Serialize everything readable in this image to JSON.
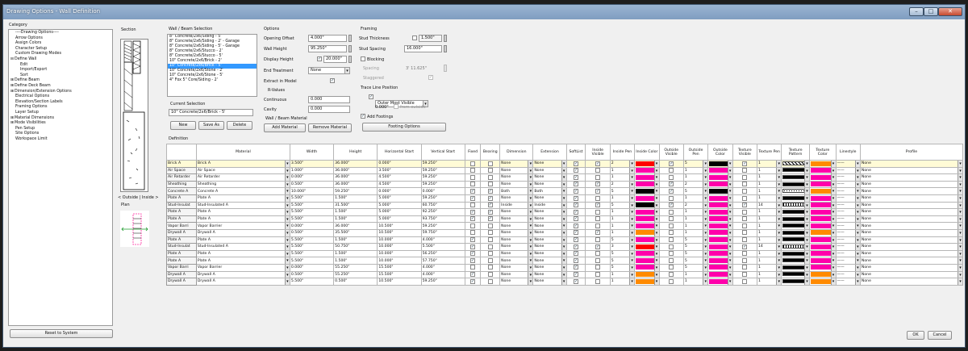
{
  "window": {
    "title": "Drawing Options - Wall Definition",
    "min": "–",
    "max": "□",
    "close": "✕"
  },
  "category": {
    "label": "Category",
    "items": [
      {
        "text": "----Drawing Options----",
        "indent": 1
      },
      {
        "text": "Arrow Options",
        "indent": 1
      },
      {
        "text": "Assign Colors",
        "indent": 1
      },
      {
        "text": "Character Setup",
        "indent": 1
      },
      {
        "text": "Custom Drawing Modes",
        "indent": 1
      },
      {
        "text": "Define Wall",
        "indent": 0,
        "exp": "⊟"
      },
      {
        "text": "Edit",
        "indent": 2
      },
      {
        "text": "Import/Export",
        "indent": 2
      },
      {
        "text": "Sort",
        "indent": 2
      },
      {
        "text": "Define Beam",
        "indent": 0,
        "exp": "⊞"
      },
      {
        "text": "Define Deck Beam",
        "indent": 0,
        "exp": "⊞"
      },
      {
        "text": "Dimension/Extension Options",
        "indent": 0,
        "exp": "⊞"
      },
      {
        "text": "Electrical Options",
        "indent": 1
      },
      {
        "text": "Elevation/Section Labels",
        "indent": 1
      },
      {
        "text": "Framing Options",
        "indent": 1
      },
      {
        "text": "Layer Setup",
        "indent": 1
      },
      {
        "text": "Material Dimensions",
        "indent": 0,
        "exp": "⊞"
      },
      {
        "text": "Mode Visibilities",
        "indent": 0,
        "exp": "⊞"
      },
      {
        "text": "Pen Setup",
        "indent": 1
      },
      {
        "text": "Site Options",
        "indent": 1
      },
      {
        "text": "Workspace Limit",
        "indent": 1
      }
    ]
  },
  "section": {
    "label": "Section",
    "outside_inside": "< Outside  |  Inside >",
    "plan": "Plan"
  },
  "wall_beam": {
    "label": "Wall / Beam Selection",
    "items": [
      "8\" Concrete/2x6/Siding - 5'",
      "8\" Concrete/2x6/Siding - 2' - Garage",
      "8\" Concrete/2x6/Siding - 5' - Garage",
      "8\" Concrete/2x6/Stucco - 2'",
      "8\" Concrete/2x6/Stucco - 5'",
      "10\" Concrete/2x6/Brick - 2'",
      "10\" Concrete/2x6/Brick - 5'",
      "10\" Concrete/2x6/Stone - 2'",
      "10\" Concrete/2x6/Stone - 5'",
      "4\" Fox 5\" Core/Siding - 2'"
    ],
    "selected_index": 6,
    "current_label": "Current Selection",
    "current_value": "10\" Concrete/2x6/Brick - 5'",
    "new": "New",
    "save_as": "Save As",
    "delete": "Delete"
  },
  "options": {
    "label": "Options",
    "opening_offset_label": "Opening Offset",
    "opening_offset": "4.000\"",
    "wall_height_label": "Wall Height",
    "wall_height": "95.250\"",
    "display_height_label": "Display Height",
    "display_height": "20.000\"",
    "end_treatment_label": "End Treatment",
    "end_treatment": "None",
    "extract_label": "Extract in Model",
    "rvalues_label": "R-Values",
    "continuous_label": "Continuous",
    "continuous": "0.000",
    "cavity_label": "Cavity",
    "cavity": "0.000",
    "material_label": "Wall / Beam Material",
    "add_material": "Add Material",
    "remove_material": "Remove Material"
  },
  "framing": {
    "label": "Framing",
    "stud_thickness_label": "Stud Thickness",
    "stud_thickness": "1.500\"",
    "stud_spacing_label": "Stud Spacing",
    "stud_spacing": "16.000\"",
    "blocking_label": "Blocking",
    "spacing_label": "Spacing",
    "spacing": "3' 11.625\"",
    "staggered_label": "Staggered",
    "trace_label": "Trace Line Position",
    "trace_value": "Outer Most Visible",
    "trace_offset": "0.000\"",
    "from_outside": "from outside",
    "add_footings": "Add Footings",
    "footing_options": "Footing Options"
  },
  "definition_label": "Definition",
  "columns": [
    "Material",
    "Width",
    "Height",
    "Horizontal Start",
    "Vertical Start",
    "Fixed",
    "Bearing",
    "Dimension",
    "Extension",
    "SoftList",
    "Inside Visible",
    "Inside Pen",
    "Inside Color",
    "Outside Visible",
    "Outside Pen",
    "Outside Color",
    "Texture Visible",
    "Texture Pen",
    "Texture Pattern",
    "Texture Color",
    "Linestyle",
    "Profile"
  ],
  "rows": [
    {
      "name": "Brick A",
      "material": "Brick A",
      "width": "3.500\"",
      "height": "36.000\"",
      "hstart": "0.000\"",
      "vstart": "59.250\"",
      "fixed": false,
      "bearing": false,
      "dim": "None",
      "ext": "None",
      "soft": true,
      "iv": true,
      "ipen": "2",
      "icolor": "#ff0000",
      "ov": true,
      "open": "5",
      "ocolor": "#000000",
      "tv": true,
      "tpen": "1",
      "tpat": "hatch",
      "tcolor": "#ff8a00",
      "line": "——",
      "profile": "None"
    },
    {
      "name": "Air Space",
      "material": "Air Space",
      "width": "1.000\"",
      "height": "36.000\"",
      "hstart": "3.500\"",
      "vstart": "59.250\"",
      "fixed": false,
      "bearing": false,
      "dim": "None",
      "ext": "None",
      "soft": true,
      "iv": false,
      "ipen": "1",
      "icolor": "#ff00aa",
      "ov": false,
      "open": "1",
      "ocolor": "#ff00aa",
      "tv": false,
      "tpen": "1",
      "tpat": "solid",
      "tcolor": "#ff00aa",
      "line": "——",
      "profile": "None"
    },
    {
      "name": "Air Retarder",
      "material": "Air Retarder",
      "width": "0.000\"",
      "height": "36.000\"",
      "hstart": "4.500\"",
      "vstart": "59.250\"",
      "fixed": false,
      "bearing": false,
      "dim": "None",
      "ext": "None",
      "soft": true,
      "iv": false,
      "ipen": "1",
      "icolor": "#ff00aa",
      "ov": false,
      "open": "1",
      "ocolor": "#ff00aa",
      "tv": false,
      "tpen": "1",
      "tpat": "solid",
      "tcolor": "#ff00aa",
      "line": "——",
      "profile": "None"
    },
    {
      "name": "Sheathing",
      "material": "Sheathing",
      "width": "0.500\"",
      "height": "36.000\"",
      "hstart": "4.500\"",
      "vstart": "59.250\"",
      "fixed": false,
      "bearing": false,
      "dim": "None",
      "ext": "None",
      "soft": true,
      "iv": true,
      "ipen": "2",
      "icolor": "#ff00aa",
      "ov": true,
      "open": "2",
      "ocolor": "#ff00aa",
      "tv": false,
      "tpen": "1",
      "tpat": "solid",
      "tcolor": "#ff00aa",
      "line": "——",
      "profile": "None"
    },
    {
      "name": "Concrete A",
      "material": "Concrete A",
      "width": "10.000\"",
      "height": "59.250\"",
      "hstart": "0.000\"",
      "vstart": "0.000\"",
      "fixed": true,
      "bearing": true,
      "dim": "Both",
      "ext": "Both",
      "soft": true,
      "iv": true,
      "ipen": "5",
      "icolor": "#000000",
      "ov": true,
      "open": "5",
      "ocolor": "#000000",
      "tv": false,
      "tpen": "1",
      "tpat": "dots",
      "tcolor": "#ff8a00",
      "line": "——",
      "profile": "None"
    },
    {
      "name": "Plate A",
      "material": "Plate A",
      "width": "5.500\"",
      "height": "1.500\"",
      "hstart": "5.000\"",
      "vstart": "59.250\"",
      "fixed": true,
      "bearing": true,
      "dim": "None",
      "ext": "None",
      "soft": true,
      "iv": false,
      "ipen": "1",
      "icolor": "#ff00aa",
      "ov": false,
      "open": "1",
      "ocolor": "#ff00aa",
      "tv": false,
      "tpen": "1",
      "tpat": "solid",
      "tcolor": "#ff00aa",
      "line": "——",
      "profile": "None"
    },
    {
      "name": "Stud-Insulat",
      "material": "Stud-Insulated A",
      "width": "5.500\"",
      "height": "31.500\"",
      "hstart": "5.000\"",
      "vstart": "60.750\"",
      "fixed": false,
      "bearing": true,
      "dim": "Inside",
      "ext": "Inside",
      "soft": true,
      "iv": true,
      "ipen": "5",
      "icolor": "#000000",
      "ov": true,
      "open": "2",
      "ocolor": "#ff00aa",
      "tv": true,
      "tpen": "14",
      "tpat": "insul",
      "tcolor": "#ff00aa",
      "line": "——",
      "profile": "None"
    },
    {
      "name": "Plate A",
      "material": "Plate A",
      "width": "5.500\"",
      "height": "1.500\"",
      "hstart": "5.000\"",
      "vstart": "92.250\"",
      "fixed": true,
      "bearing": true,
      "dim": "None",
      "ext": "None",
      "soft": true,
      "iv": false,
      "ipen": "1",
      "icolor": "#ff00aa",
      "ov": false,
      "open": "1",
      "ocolor": "#ff00aa",
      "tv": false,
      "tpen": "1",
      "tpat": "solid",
      "tcolor": "#ff00aa",
      "line": "——",
      "profile": "None"
    },
    {
      "name": "Plate A",
      "material": "Plate A",
      "width": "5.500\"",
      "height": "1.500\"",
      "hstart": "5.000\"",
      "vstart": "93.750\"",
      "fixed": true,
      "bearing": true,
      "dim": "None",
      "ext": "None",
      "soft": true,
      "iv": false,
      "ipen": "1",
      "icolor": "#ff00aa",
      "ov": false,
      "open": "1",
      "ocolor": "#ff00aa",
      "tv": false,
      "tpen": "1",
      "tpat": "solid",
      "tcolor": "#ff00aa",
      "line": "——",
      "profile": "None"
    },
    {
      "name": "Vapor Barri",
      "material": "Vapor Barrier",
      "width": "0.000\"",
      "height": "36.000\"",
      "hstart": "10.500\"",
      "vstart": "59.250\"",
      "fixed": false,
      "bearing": false,
      "dim": "None",
      "ext": "None",
      "soft": true,
      "iv": false,
      "ipen": "1",
      "icolor": "#ff00aa",
      "ov": false,
      "open": "1",
      "ocolor": "#ff00aa",
      "tv": false,
      "tpen": "1",
      "tpat": "solid",
      "tcolor": "#ff00aa",
      "line": "——",
      "profile": "None"
    },
    {
      "name": "Drywall A",
      "material": "Drywall A",
      "width": "0.500\"",
      "height": "35.500\"",
      "hstart": "10.500\"",
      "vstart": "59.750\"",
      "fixed": false,
      "bearing": false,
      "dim": "None",
      "ext": "None",
      "soft": true,
      "iv": true,
      "ipen": "1",
      "icolor": "#ff8a00",
      "ov": false,
      "open": "1",
      "ocolor": "#ff00aa",
      "tv": false,
      "tpen": "1",
      "tpat": "solid",
      "tcolor": "#ff8a00",
      "line": "——",
      "profile": "None"
    },
    {
      "name": "Plate A",
      "material": "Plate A",
      "width": "5.500\"",
      "height": "1.500\"",
      "hstart": "10.000\"",
      "vstart": "4.000\"",
      "fixed": true,
      "bearing": false,
      "dim": "None",
      "ext": "None",
      "soft": true,
      "iv": false,
      "ipen": "5",
      "icolor": "#ff00aa",
      "ov": false,
      "open": "5",
      "ocolor": "#ff00aa",
      "tv": false,
      "tpen": "1",
      "tpat": "solid",
      "tcolor": "#ff00aa",
      "line": "——",
      "profile": "None"
    },
    {
      "name": "Stud-Insulat",
      "material": "Stud-Insulated A",
      "width": "5.500\"",
      "height": "50.750\"",
      "hstart": "10.000\"",
      "vstart": "5.500\"",
      "fixed": true,
      "bearing": false,
      "dim": "None",
      "ext": "None",
      "soft": true,
      "iv": true,
      "ipen": "3",
      "icolor": "#ff0000",
      "ov": false,
      "open": "5",
      "ocolor": "#ff00aa",
      "tv": true,
      "tpen": "14",
      "tpat": "insul",
      "tcolor": "#ff00aa",
      "line": "——",
      "profile": "None"
    },
    {
      "name": "Plate A",
      "material": "Plate A",
      "width": "5.500\"",
      "height": "1.500\"",
      "hstart": "10.000\"",
      "vstart": "56.250\"",
      "fixed": true,
      "bearing": false,
      "dim": "None",
      "ext": "None",
      "soft": true,
      "iv": false,
      "ipen": "5",
      "icolor": "#ff00aa",
      "ov": false,
      "open": "5",
      "ocolor": "#ff00aa",
      "tv": false,
      "tpen": "1",
      "tpat": "solid",
      "tcolor": "#ff00aa",
      "line": "——",
      "profile": "None"
    },
    {
      "name": "Plate A",
      "material": "Plate A",
      "width": "5.500\"",
      "height": "1.500\"",
      "hstart": "10.000\"",
      "vstart": "57.750\"",
      "fixed": true,
      "bearing": false,
      "dim": "None",
      "ext": "None",
      "soft": true,
      "iv": false,
      "ipen": "5",
      "icolor": "#ff00aa",
      "ov": false,
      "open": "5",
      "ocolor": "#ff00aa",
      "tv": false,
      "tpen": "1",
      "tpat": "solid",
      "tcolor": "#ff00aa",
      "line": "——",
      "profile": "None"
    },
    {
      "name": "Vapor Barri",
      "material": "Vapor Barrier",
      "width": "0.000\"",
      "height": "55.250\"",
      "hstart": "15.500\"",
      "vstart": "4.000\"",
      "fixed": false,
      "bearing": false,
      "dim": "None",
      "ext": "None",
      "soft": true,
      "iv": false,
      "ipen": "5",
      "icolor": "#ff00aa",
      "ov": false,
      "open": "5",
      "ocolor": "#ff00aa",
      "tv": false,
      "tpen": "1",
      "tpat": "solid",
      "tcolor": "#ff00aa",
      "line": "——",
      "profile": "None"
    },
    {
      "name": "Drywall A",
      "material": "Drywall A",
      "width": "0.500\"",
      "height": "55.250\"",
      "hstart": "15.500\"",
      "vstart": "4.000\"",
      "fixed": true,
      "bearing": false,
      "dim": "None",
      "ext": "None",
      "soft": true,
      "iv": false,
      "ipen": "1",
      "icolor": "#ff8a00",
      "ov": false,
      "open": "1",
      "ocolor": "#ff00aa",
      "tv": false,
      "tpen": "1",
      "tpat": "solid",
      "tcolor": "#ff8a00",
      "line": "——",
      "profile": "None"
    },
    {
      "name": "Drywall A",
      "material": "Drywall A",
      "width": "5.500\"",
      "height": "0.500\"",
      "hstart": "10.500\"",
      "vstart": "59.250\"",
      "fixed": true,
      "bearing": false,
      "dim": "None",
      "ext": "None",
      "soft": true,
      "iv": false,
      "ipen": "1",
      "icolor": "#ff8a00",
      "ov": false,
      "open": "1",
      "ocolor": "#ff00aa",
      "tv": false,
      "tpen": "1",
      "tpat": "solid",
      "tcolor": "#ff8a00",
      "line": "——",
      "profile": "None"
    }
  ],
  "footer": {
    "reset": "Reset to System",
    "ok": "OK",
    "cancel": "Cancel"
  },
  "check_glyph": "✓"
}
